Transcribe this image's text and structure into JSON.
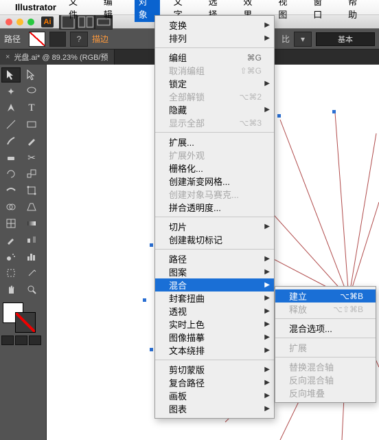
{
  "menubar": {
    "apple": "",
    "app": "Illustrator",
    "items": [
      "文件",
      "编辑",
      "对象",
      "文字",
      "选择",
      "效果",
      "视图",
      "窗口",
      "帮助"
    ],
    "active_index": 2
  },
  "titlebar": {
    "ai": "Ai"
  },
  "controlbar": {
    "path_label": "路径",
    "stroke_label": "描边",
    "question": "?",
    "basic_label": "基本",
    "ratio_suffix": "比"
  },
  "doctab": {
    "close": "×",
    "label": "光盘.ai* @ 89.23% (RGB/预"
  },
  "object_menu": [
    {
      "type": "item",
      "label": "变换",
      "arrow": true
    },
    {
      "type": "item",
      "label": "排列",
      "arrow": true
    },
    {
      "type": "sep"
    },
    {
      "type": "item",
      "label": "编组",
      "sc": "⌘G"
    },
    {
      "type": "item",
      "label": "取消编组",
      "sc": "⇧⌘G",
      "disabled": true
    },
    {
      "type": "item",
      "label": "锁定",
      "arrow": true
    },
    {
      "type": "item",
      "label": "全部解锁",
      "sc": "⌥⌘2",
      "disabled": true
    },
    {
      "type": "item",
      "label": "隐藏",
      "arrow": true
    },
    {
      "type": "item",
      "label": "显示全部",
      "sc": "⌥⌘3",
      "disabled": true
    },
    {
      "type": "sep"
    },
    {
      "type": "item",
      "label": "扩展..."
    },
    {
      "type": "item",
      "label": "扩展外观",
      "disabled": true
    },
    {
      "type": "item",
      "label": "栅格化..."
    },
    {
      "type": "item",
      "label": "创建渐变网格..."
    },
    {
      "type": "item",
      "label": "创建对象马赛克...",
      "disabled": true
    },
    {
      "type": "item",
      "label": "拼合透明度..."
    },
    {
      "type": "sep"
    },
    {
      "type": "item",
      "label": "切片",
      "arrow": true
    },
    {
      "type": "item",
      "label": "创建裁切标记"
    },
    {
      "type": "sep"
    },
    {
      "type": "item",
      "label": "路径",
      "arrow": true
    },
    {
      "type": "item",
      "label": "图案",
      "arrow": true
    },
    {
      "type": "item",
      "label": "混合",
      "arrow": true,
      "hl": true
    },
    {
      "type": "item",
      "label": "封套扭曲",
      "arrow": true
    },
    {
      "type": "item",
      "label": "透视",
      "arrow": true
    },
    {
      "type": "item",
      "label": "实时上色",
      "arrow": true
    },
    {
      "type": "item",
      "label": "图像描摹",
      "arrow": true
    },
    {
      "type": "item",
      "label": "文本绕排",
      "arrow": true
    },
    {
      "type": "sep"
    },
    {
      "type": "item",
      "label": "剪切蒙版",
      "arrow": true
    },
    {
      "type": "item",
      "label": "复合路径",
      "arrow": true
    },
    {
      "type": "item",
      "label": "画板",
      "arrow": true
    },
    {
      "type": "item",
      "label": "图表",
      "arrow": true
    }
  ],
  "blend_submenu": [
    {
      "type": "item",
      "label": "建立",
      "sc": "⌥⌘B",
      "hl": true
    },
    {
      "type": "item",
      "label": "释放",
      "sc": "⌥⇧⌘B",
      "disabled": true
    },
    {
      "type": "sep"
    },
    {
      "type": "item",
      "label": "混合选项..."
    },
    {
      "type": "sep"
    },
    {
      "type": "item",
      "label": "扩展",
      "disabled": true
    },
    {
      "type": "sep"
    },
    {
      "type": "item",
      "label": "替换混合轴",
      "disabled": true
    },
    {
      "type": "item",
      "label": "反向混合轴",
      "disabled": true
    },
    {
      "type": "item",
      "label": "反向堆叠",
      "disabled": true
    }
  ],
  "tools": [
    "selection",
    "direct-selection",
    "magic-wand",
    "lasso",
    "pen",
    "curvature",
    "type",
    "line",
    "rectangle",
    "brush",
    "pencil",
    "eraser",
    "rotate",
    "scale",
    "width",
    "free-transform",
    "shape-builder",
    "perspective",
    "mesh",
    "gradient",
    "eyedropper",
    "blend",
    "symbol-sprayer",
    "graph",
    "artboard",
    "slice",
    "hand",
    "zoom"
  ]
}
